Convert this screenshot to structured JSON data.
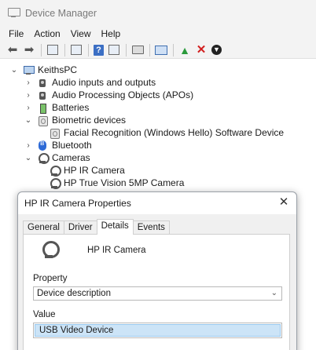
{
  "window": {
    "title": "Device Manager"
  },
  "menu": [
    "File",
    "Action",
    "View",
    "Help"
  ],
  "tree": {
    "root": "KeithsPC",
    "items": [
      {
        "label": "Audio inputs and outputs",
        "expanded": false
      },
      {
        "label": "Audio Processing Objects (APOs)",
        "expanded": false
      },
      {
        "label": "Batteries",
        "expanded": false
      },
      {
        "label": "Biometric devices",
        "expanded": true
      },
      {
        "label": "Facial Recognition (Windows Hello) Software Device",
        "child": true
      },
      {
        "label": "Bluetooth",
        "expanded": false
      },
      {
        "label": "Cameras",
        "expanded": true
      },
      {
        "label": "HP IR Camera",
        "child": true
      },
      {
        "label": "HP True Vision 5MP Camera",
        "child": true
      }
    ]
  },
  "dialog": {
    "title": "HP IR Camera Properties",
    "tabs": [
      "General",
      "Driver",
      "Details",
      "Events"
    ],
    "active_tab": "Details",
    "device_name": "HP IR Camera",
    "property_label": "Property",
    "property_value": "Device description",
    "value_label": "Value",
    "value_item": "USB Video Device"
  }
}
